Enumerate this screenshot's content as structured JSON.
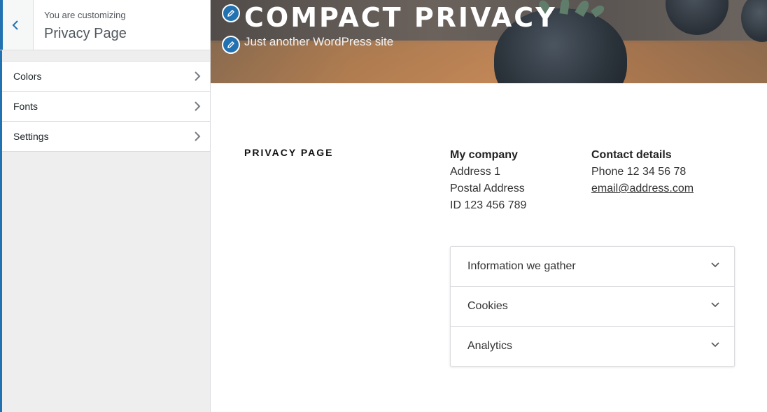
{
  "customizer": {
    "customizing_label": "You are customizing",
    "title": "Privacy Page",
    "panels": [
      {
        "label": "Colors"
      },
      {
        "label": "Fonts"
      },
      {
        "label": "Settings"
      }
    ],
    "accent_color": "#2271b1"
  },
  "site": {
    "title": "COMPACT PRIVACY",
    "tagline": "Just another WordPress site"
  },
  "page": {
    "heading": "PRIVACY PAGE",
    "company": {
      "title": "My company",
      "lines": [
        "Address 1",
        "Postal Address",
        "ID 123 456 789"
      ]
    },
    "contact": {
      "title": "Contact details",
      "phone": "Phone 12 34 56 78",
      "email": "email@address.com"
    },
    "accordion": [
      {
        "label": "Information we gather"
      },
      {
        "label": "Cookies"
      },
      {
        "label": "Analytics"
      }
    ]
  },
  "icons": {
    "back": "chevron-left-icon",
    "panel_arrow": "chevron-right-icon",
    "edit": "pencil-icon",
    "accordion_toggle": "chevron-down-icon"
  }
}
